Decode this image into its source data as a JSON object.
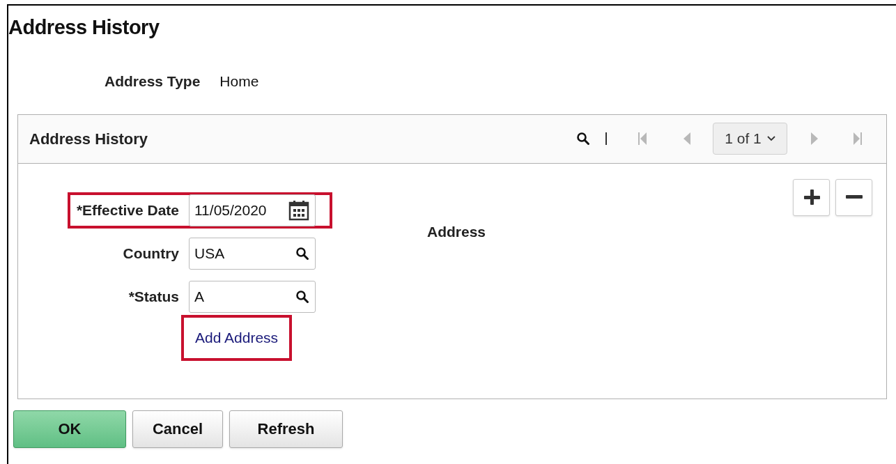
{
  "page_title": "Address History",
  "address_type": {
    "label": "Address Type",
    "value": "Home"
  },
  "panel": {
    "title": "Address History",
    "pager": {
      "range": "1 of 1",
      "first_disabled": true,
      "prev_disabled": true,
      "next_disabled": true,
      "last_disabled": true
    },
    "fields": [
      {
        "kind": "date",
        "label": "*Effective Date",
        "value": "11/05/2020",
        "highlighted": true
      },
      {
        "kind": "lookup",
        "label": "Country",
        "value": "USA",
        "highlighted": false
      },
      {
        "kind": "lookup",
        "label": "*Status",
        "value": "A",
        "highlighted": false
      }
    ],
    "link": {
      "label": "Add Address",
      "highlighted": true
    },
    "address_label": "Address"
  },
  "buttons": [
    {
      "label": "OK",
      "kind": "primary"
    },
    {
      "label": "Cancel",
      "kind": "default"
    },
    {
      "label": "Refresh",
      "kind": "default"
    }
  ]
}
